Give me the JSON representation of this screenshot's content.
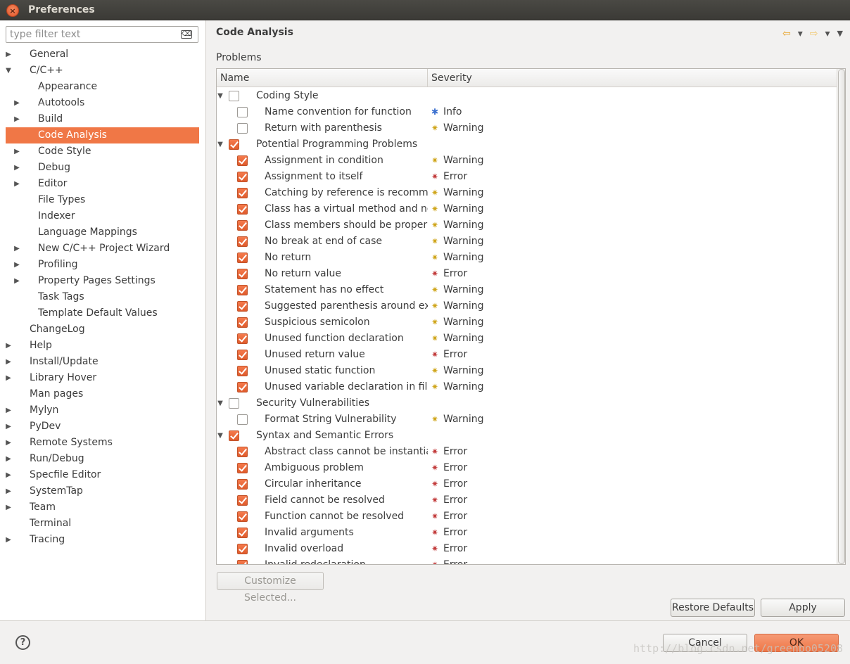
{
  "window": {
    "title": "Preferences",
    "close_glyph": "×"
  },
  "filter": {
    "placeholder": "type filter text",
    "clear_glyph": "⌫"
  },
  "tree": [
    {
      "label": "General",
      "level": 0,
      "expander": "collapsed"
    },
    {
      "label": "C/C++",
      "level": 0,
      "expander": "expanded"
    },
    {
      "label": "Appearance",
      "level": 1,
      "expander": "none"
    },
    {
      "label": "Autotools",
      "level": 1,
      "expander": "collapsed"
    },
    {
      "label": "Build",
      "level": 1,
      "expander": "collapsed"
    },
    {
      "label": "Code Analysis",
      "level": 1,
      "expander": "none",
      "selected": true
    },
    {
      "label": "Code Style",
      "level": 1,
      "expander": "collapsed"
    },
    {
      "label": "Debug",
      "level": 1,
      "expander": "collapsed"
    },
    {
      "label": "Editor",
      "level": 1,
      "expander": "collapsed"
    },
    {
      "label": "File Types",
      "level": 1,
      "expander": "none"
    },
    {
      "label": "Indexer",
      "level": 1,
      "expander": "none"
    },
    {
      "label": "Language Mappings",
      "level": 1,
      "expander": "none"
    },
    {
      "label": "New C/C++ Project Wizard",
      "level": 1,
      "expander": "collapsed"
    },
    {
      "label": "Profiling",
      "level": 1,
      "expander": "collapsed"
    },
    {
      "label": "Property Pages Settings",
      "level": 1,
      "expander": "collapsed"
    },
    {
      "label": "Task Tags",
      "level": 1,
      "expander": "none"
    },
    {
      "label": "Template Default Values",
      "level": 1,
      "expander": "none"
    },
    {
      "label": "ChangeLog",
      "level": 0,
      "expander": "none"
    },
    {
      "label": "Help",
      "level": 0,
      "expander": "collapsed"
    },
    {
      "label": "Install/Update",
      "level": 0,
      "expander": "collapsed"
    },
    {
      "label": "Library Hover",
      "level": 0,
      "expander": "collapsed"
    },
    {
      "label": "Man pages",
      "level": 0,
      "expander": "none"
    },
    {
      "label": "Mylyn",
      "level": 0,
      "expander": "collapsed"
    },
    {
      "label": "PyDev",
      "level": 0,
      "expander": "collapsed"
    },
    {
      "label": "Remote Systems",
      "level": 0,
      "expander": "collapsed"
    },
    {
      "label": "Run/Debug",
      "level": 0,
      "expander": "collapsed"
    },
    {
      "label": "Specfile Editor",
      "level": 0,
      "expander": "collapsed"
    },
    {
      "label": "SystemTap",
      "level": 0,
      "expander": "collapsed"
    },
    {
      "label": "Team",
      "level": 0,
      "expander": "collapsed"
    },
    {
      "label": "Terminal",
      "level": 0,
      "expander": "none"
    },
    {
      "label": "Tracing",
      "level": 0,
      "expander": "collapsed"
    }
  ],
  "page": {
    "title": "Code Analysis",
    "section_label": "Problems",
    "nav": {
      "back_glyph": "⇦",
      "forward_glyph": "⇨",
      "dropdown_glyph": "▾",
      "menu_glyph": "▼"
    },
    "columns": {
      "name": "Name",
      "severity": "Severity"
    },
    "rows": [
      {
        "type": "group",
        "name": "Coding Style",
        "checked": false
      },
      {
        "type": "item",
        "name": "Name convention for function",
        "checked": false,
        "severity": "Info",
        "icon": "info-bug-icon"
      },
      {
        "type": "item",
        "name": "Return with parenthesis",
        "checked": false,
        "severity": "Warning",
        "icon": "warning-bug-icon"
      },
      {
        "type": "group",
        "name": "Potential Programming Problems",
        "checked": true
      },
      {
        "type": "item",
        "name": "Assignment in condition",
        "checked": true,
        "severity": "Warning",
        "icon": "warning-bug-icon"
      },
      {
        "type": "item",
        "name": "Assignment to itself",
        "checked": true,
        "severity": "Error",
        "icon": "error-bug-icon"
      },
      {
        "type": "item",
        "name": "Catching by reference is recommended",
        "checked": true,
        "severity": "Warning",
        "icon": "warning-bug-icon"
      },
      {
        "type": "item",
        "name": "Class has a virtual method and non-virtual destructor",
        "checked": true,
        "severity": "Warning",
        "icon": "warning-bug-icon"
      },
      {
        "type": "item",
        "name": "Class members should be properly initialized",
        "checked": true,
        "severity": "Warning",
        "icon": "warning-bug-icon"
      },
      {
        "type": "item",
        "name": "No break at end of case",
        "checked": true,
        "severity": "Warning",
        "icon": "warning-bug-icon"
      },
      {
        "type": "item",
        "name": "No return",
        "checked": true,
        "severity": "Warning",
        "icon": "warning-bug-icon"
      },
      {
        "type": "item",
        "name": "No return value",
        "checked": true,
        "severity": "Error",
        "icon": "error-bug-icon"
      },
      {
        "type": "item",
        "name": "Statement has no effect",
        "checked": true,
        "severity": "Warning",
        "icon": "warning-bug-icon"
      },
      {
        "type": "item",
        "name": "Suggested parenthesis around expression",
        "checked": true,
        "severity": "Warning",
        "icon": "warning-bug-icon"
      },
      {
        "type": "item",
        "name": "Suspicious semicolon",
        "checked": true,
        "severity": "Warning",
        "icon": "warning-bug-icon"
      },
      {
        "type": "item",
        "name": "Unused function declaration",
        "checked": true,
        "severity": "Warning",
        "icon": "warning-bug-icon"
      },
      {
        "type": "item",
        "name": "Unused return value",
        "checked": true,
        "severity": "Error",
        "icon": "error-bug-icon"
      },
      {
        "type": "item",
        "name": "Unused static function",
        "checked": true,
        "severity": "Warning",
        "icon": "warning-bug-icon"
      },
      {
        "type": "item",
        "name": "Unused variable declaration in file scope",
        "checked": true,
        "severity": "Warning",
        "icon": "warning-bug-icon"
      },
      {
        "type": "group",
        "name": "Security Vulnerabilities",
        "checked": false
      },
      {
        "type": "item",
        "name": "Format String Vulnerability",
        "checked": false,
        "severity": "Warning",
        "icon": "warning-bug-icon"
      },
      {
        "type": "group",
        "name": "Syntax and Semantic Errors",
        "checked": true
      },
      {
        "type": "item",
        "name": "Abstract class cannot be instantiated",
        "checked": true,
        "severity": "Error",
        "icon": "error-bug-icon"
      },
      {
        "type": "item",
        "name": "Ambiguous problem",
        "checked": true,
        "severity": "Error",
        "icon": "error-bug-icon"
      },
      {
        "type": "item",
        "name": "Circular inheritance",
        "checked": true,
        "severity": "Error",
        "icon": "error-bug-icon"
      },
      {
        "type": "item",
        "name": "Field cannot be resolved",
        "checked": true,
        "severity": "Error",
        "icon": "error-bug-icon"
      },
      {
        "type": "item",
        "name": "Function cannot be resolved",
        "checked": true,
        "severity": "Error",
        "icon": "error-bug-icon"
      },
      {
        "type": "item",
        "name": "Invalid arguments",
        "checked": true,
        "severity": "Error",
        "icon": "error-bug-icon"
      },
      {
        "type": "item",
        "name": "Invalid overload",
        "checked": true,
        "severity": "Error",
        "icon": "error-bug-icon"
      },
      {
        "type": "item",
        "name": "Invalid redeclaration",
        "checked": true,
        "severity": "Error",
        "icon": "error-bug-icon"
      }
    ],
    "buttons": {
      "customize": "Customize Selected...",
      "restore_defaults": "Restore Defaults",
      "apply": "Apply"
    }
  },
  "footer": {
    "help_glyph": "?",
    "cancel": "Cancel",
    "ok": "OK",
    "watermark": "http://blog.csdn.net/greenbo05208"
  },
  "colors": {
    "accent": "#f07746",
    "warning": "#cfa51a",
    "error": "#c23b3b",
    "info": "#3a6fcf"
  }
}
